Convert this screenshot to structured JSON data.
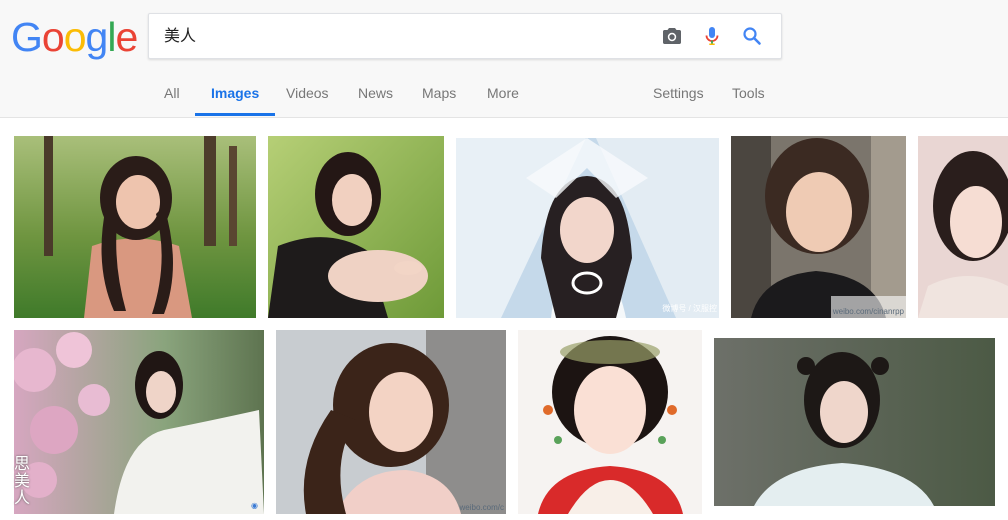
{
  "logo": {
    "letters": [
      "G",
      "o",
      "o",
      "g",
      "l",
      "e"
    ],
    "colors": [
      "#4285F4",
      "#EA4335",
      "#FBBC05",
      "#4285F4",
      "#34A853",
      "#EA4335"
    ]
  },
  "search": {
    "query": "美人",
    "icons": [
      "camera-icon",
      "microphone-icon",
      "search-icon"
    ]
  },
  "tabs": [
    {
      "label": "All"
    },
    {
      "label": "Images",
      "active": true
    },
    {
      "label": "Videos"
    },
    {
      "label": "News"
    },
    {
      "label": "Maps"
    },
    {
      "label": "More"
    }
  ],
  "tools": {
    "settings": "Settings",
    "tools": "Tools"
  },
  "colors": {
    "accent": "#1a73e8",
    "tab_text": "#777777",
    "header_bg": "#f8f8f8"
  },
  "watermarks": {
    "img3": "微博号 / 汉服控",
    "img4": "weibo.com/cinanrpp",
    "img8": "weibo.com/c",
    "img6_text": "思美人"
  }
}
